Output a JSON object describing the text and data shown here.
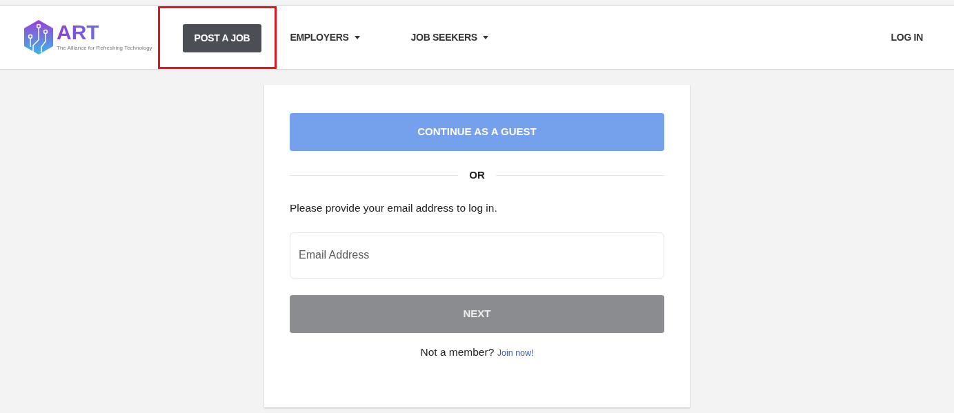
{
  "logo": {
    "name": "ART",
    "tagline": "The Alliance for Refreshing Technology"
  },
  "nav": [
    {
      "kind": "button",
      "label": "POST A JOB",
      "highlighted": true
    },
    {
      "kind": "dropdown",
      "label": "EMPLOYERS",
      "highlighted": false
    },
    {
      "kind": "dropdown",
      "label": "JOB SEEKERS",
      "highlighted": false
    }
  ],
  "login_link": "LOG IN",
  "card": {
    "guest_button": "CONTINUE AS A GUEST",
    "divider": "OR",
    "prompt": "Please provide your email address to log in.",
    "email": {
      "placeholder": "Email Address"
    },
    "next_button": {
      "label": "NEXT",
      "disabled": true
    },
    "signup_text": "Not a member?",
    "signup_link": "Join now!"
  }
}
